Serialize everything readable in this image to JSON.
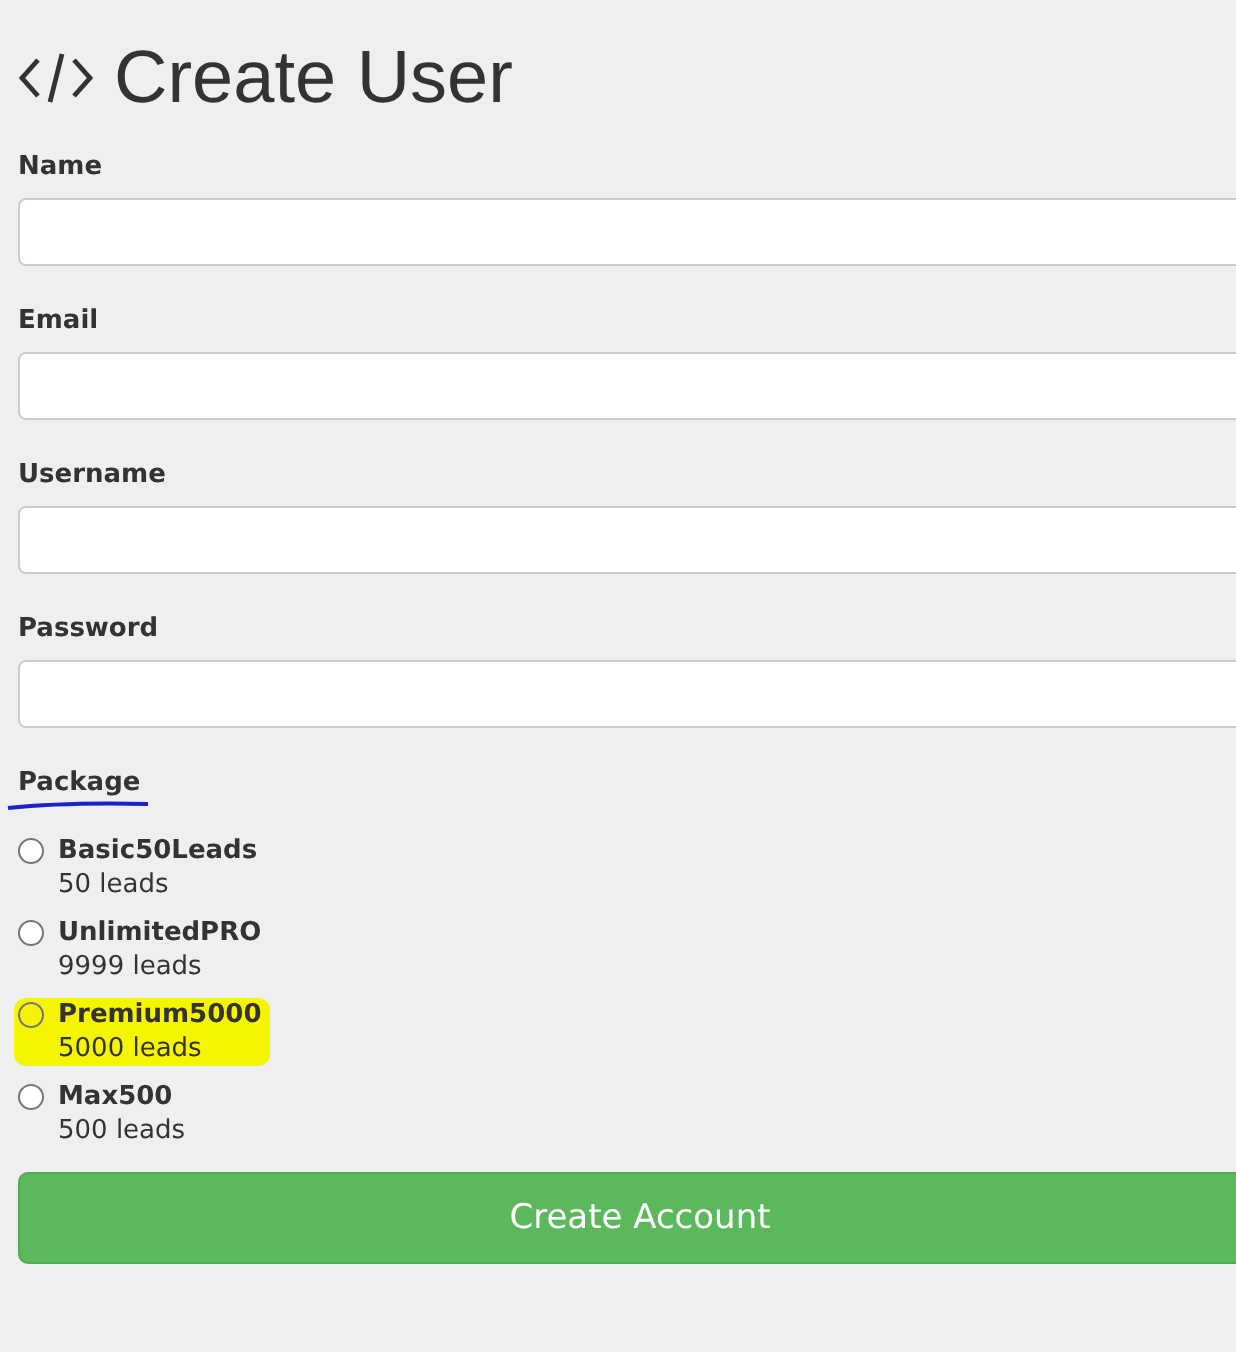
{
  "title": "Create User",
  "fields": [
    {
      "label": "Name"
    },
    {
      "label": "Email"
    },
    {
      "label": "Username"
    },
    {
      "label": "Password"
    }
  ],
  "package": {
    "label": "Package",
    "underlined": true,
    "options": [
      {
        "name": "Basic50Leads",
        "detail": "50 leads",
        "selected": false,
        "highlighted": false
      },
      {
        "name": "UnlimitedPRO",
        "detail": "9999 leads",
        "selected": false,
        "highlighted": false
      },
      {
        "name": "Premium5000",
        "detail": "5000 leads",
        "selected": false,
        "highlighted": true
      },
      {
        "name": "Max500",
        "detail": "500 leads",
        "selected": false,
        "highlighted": false
      }
    ]
  },
  "submit": "Create Account"
}
